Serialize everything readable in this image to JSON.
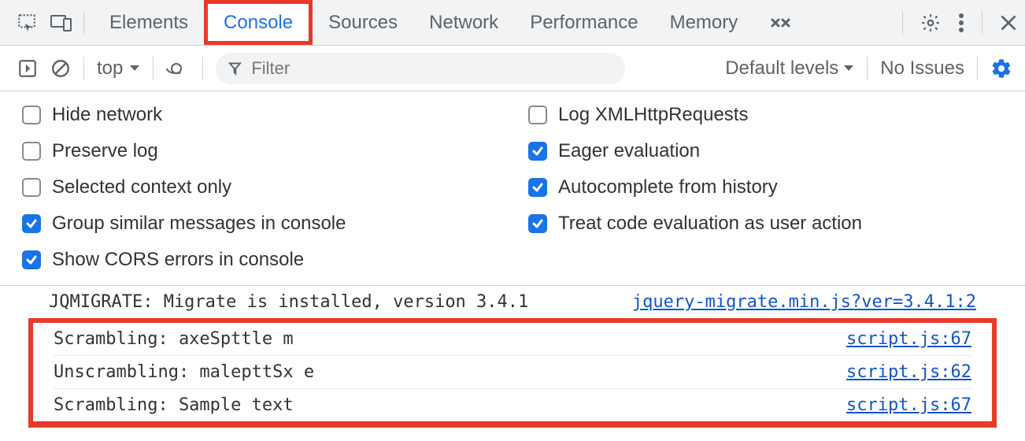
{
  "topbar": {
    "tabs": [
      "Elements",
      "Console",
      "Sources",
      "Network",
      "Performance",
      "Memory"
    ],
    "active_tab": "Console"
  },
  "toolbar": {
    "context": "top",
    "filter_placeholder": "Filter",
    "levels_label": "Default levels",
    "issues_label": "No Issues"
  },
  "settings": {
    "left": [
      {
        "label": "Hide network",
        "checked": false
      },
      {
        "label": "Preserve log",
        "checked": false
      },
      {
        "label": "Selected context only",
        "checked": false
      },
      {
        "label": "Group similar messages in console",
        "checked": true
      },
      {
        "label": "Show CORS errors in console",
        "checked": true
      }
    ],
    "right": [
      {
        "label": "Log XMLHttpRequests",
        "checked": false
      },
      {
        "label": "Eager evaluation",
        "checked": true
      },
      {
        "label": "Autocomplete from history",
        "checked": true
      },
      {
        "label": "Treat code evaluation as user action",
        "checked": true
      }
    ]
  },
  "logs": [
    {
      "msg": "JQMIGRATE: Migrate is installed, version 3.4.1",
      "src": "jquery-migrate.min.js?ver=3.4.1:2",
      "hl": false
    },
    {
      "msg": "Scrambling: axeSpttle m",
      "src": "script.js:67",
      "hl": true
    },
    {
      "msg": "Unscrambling: malepttSx e",
      "src": "script.js:62",
      "hl": true
    },
    {
      "msg": "Scrambling: Sample text",
      "src": "script.js:67",
      "hl": true
    }
  ]
}
